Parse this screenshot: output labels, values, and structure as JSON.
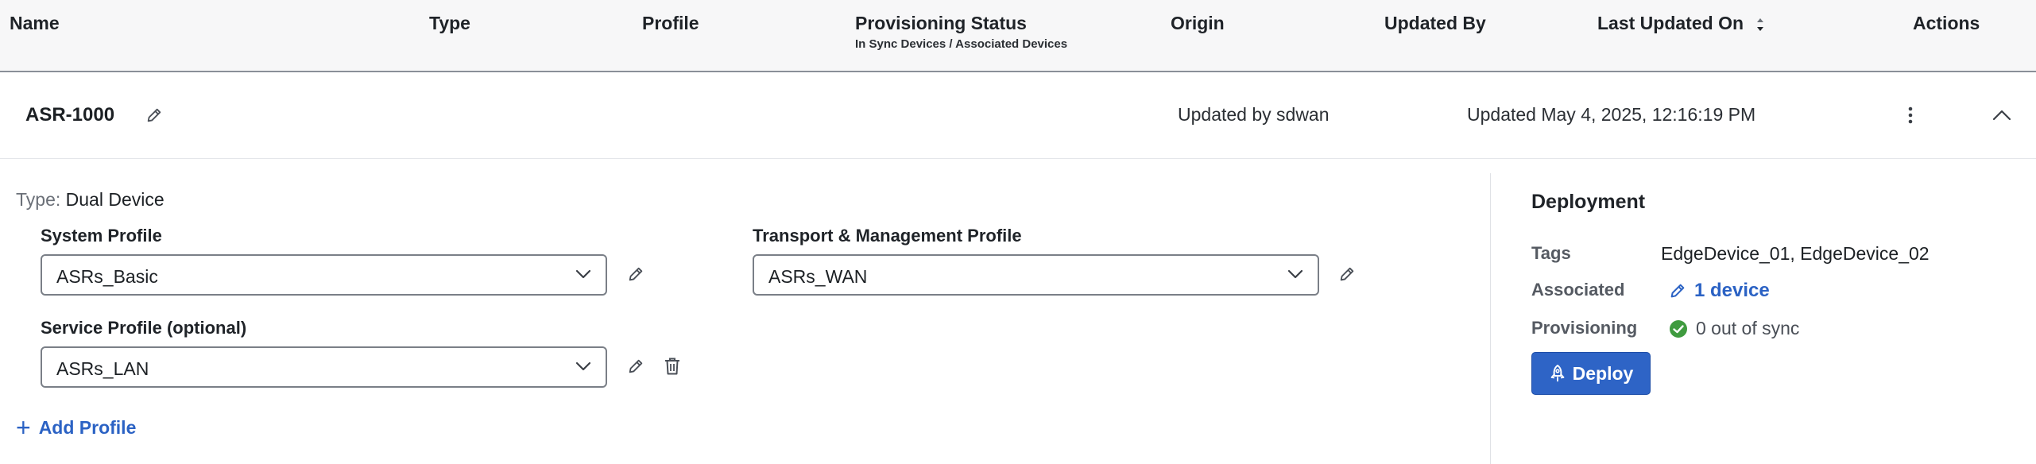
{
  "table": {
    "columns": {
      "name": "Name",
      "type": "Type",
      "profile": "Profile",
      "provisioning_status": "Provisioning Status",
      "provisioning_sub": "In Sync Devices / Associated Devices",
      "origin": "Origin",
      "updated_by": "Updated By",
      "last_updated_on": "Last Updated On",
      "actions": "Actions"
    }
  },
  "row": {
    "name": "ASR-1000",
    "updated_by": "Updated by sdwan",
    "last_updated": "Updated May 4, 2025, 12:16:19 PM"
  },
  "detail": {
    "type_key": "Type:",
    "type_value": "Dual Device",
    "system_profile": {
      "label": "System Profile",
      "value": "ASRs_Basic"
    },
    "transport_profile": {
      "label": "Transport & Management Profile",
      "value": "ASRs_WAN"
    },
    "service_profile": {
      "label": "Service Profile (optional)",
      "value": "ASRs_LAN"
    },
    "add_profile": "Add Profile"
  },
  "deployment": {
    "title": "Deployment",
    "tags_key": "Tags",
    "tags_value": "EdgeDevice_01, EdgeDevice_02",
    "associated_key": "Associated",
    "associated_value": "1 device",
    "provisioning_key": "Provisioning",
    "provisioning_value": "0 out of sync",
    "deploy_label": "Deploy"
  },
  "colors": {
    "accent": "#2e64c6",
    "link": "#2b62c4",
    "success": "#3f9b3f"
  }
}
